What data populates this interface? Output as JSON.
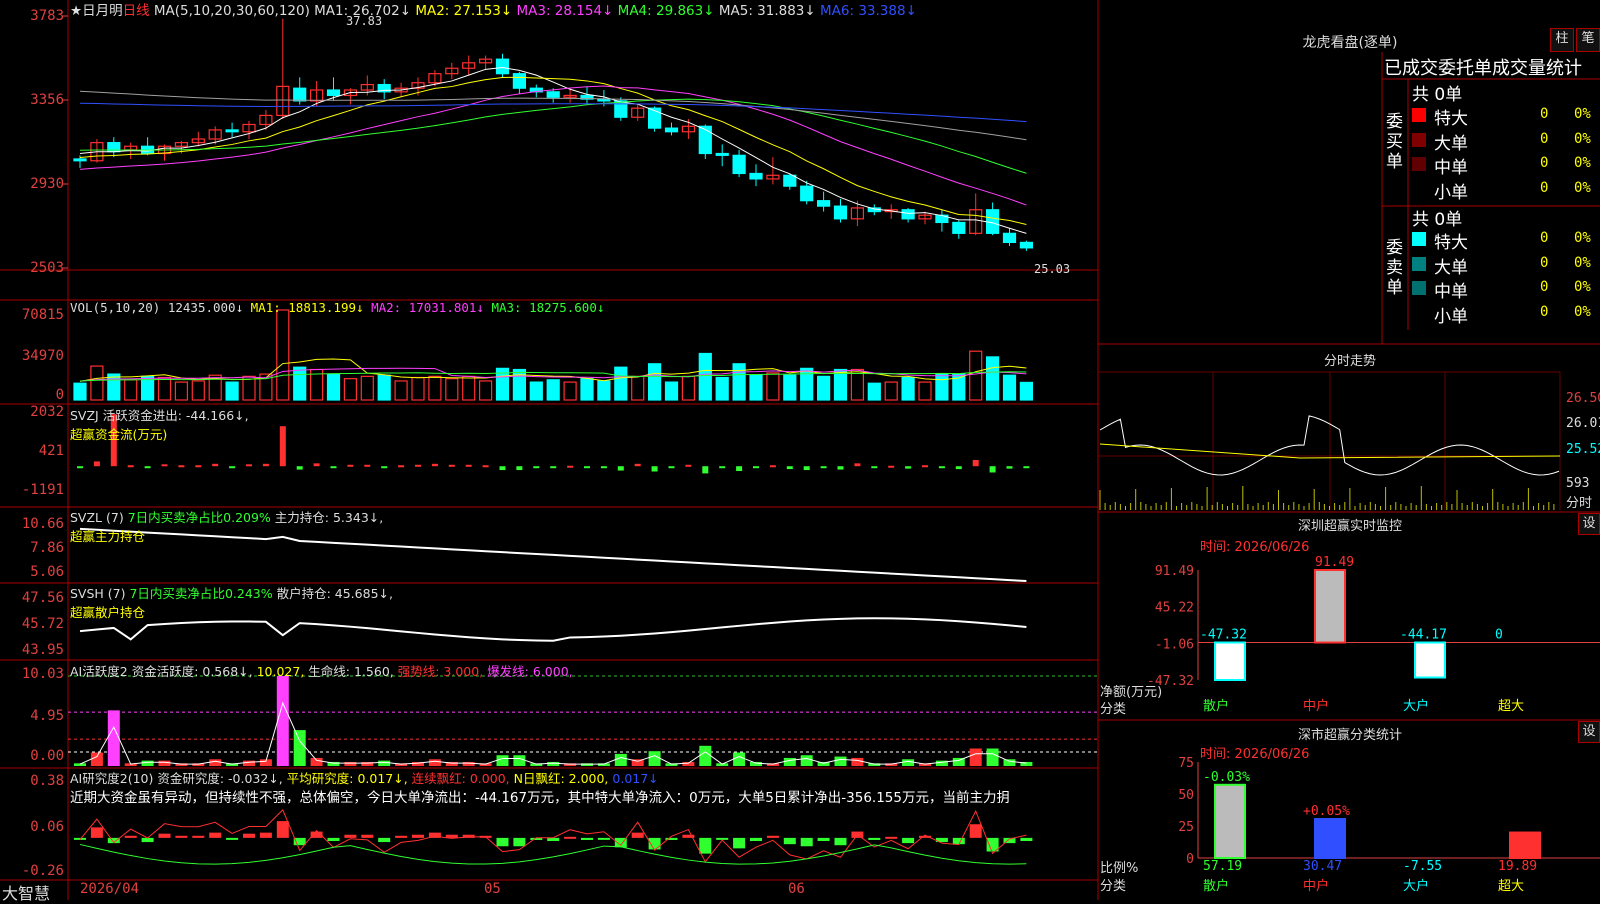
{
  "colors": {
    "up": "#ff3030",
    "down": "#00ffff",
    "grid": "#aa0000",
    "ma1": "#ffffff",
    "ma2": "#ffff00",
    "ma3": "#ff40ff",
    "ma4": "#30ff30",
    "ma5": "#a0a0a0",
    "ma6": "#3050ff"
  },
  "header": {
    "star_label": "★日月明",
    "period": "日线",
    "ma_def": "MA(5,10,20,30,60,120)",
    "ma1": "MA1: 26.702↓",
    "ma2": "MA2: 27.153↓",
    "ma3": "MA3: 28.154↓",
    "ma4": "MA4: 29.863↓",
    "ma5": "MA5: 31.883↓",
    "ma6": "MA6: 33.388↓",
    "high_mark": "37.83",
    "low_mark": "25.03"
  },
  "price_axis": [
    "3783",
    "3356",
    "2930",
    "2503"
  ],
  "vol": {
    "label": "VOL(5,10,20)",
    "v": "12435.000↓",
    "ma1": "MA1: 18813.199↓",
    "ma2": "MA2: 17031.801↓",
    "ma3": "MA3: 18275.600↓",
    "axis": [
      "70815",
      "34970",
      "0"
    ]
  },
  "svzj": {
    "label": "SVZJ",
    "text": "活跃资金进出: -44.166↓,",
    "sub": "超赢资金流(万元)",
    "axis": [
      "2032",
      "421",
      "-1191"
    ]
  },
  "svzl": {
    "label": "SVZL (7)",
    "text1": "7日内买卖净占比0.209%",
    "text2": "主力持仓: 5.343↓,",
    "sub": "超赢主力持仓",
    "axis": [
      "10.66",
      "7.86",
      "5.06"
    ]
  },
  "svsh": {
    "label": "SVSH (7)",
    "text1": "7日内买卖净占比0.243%",
    "text2": "散户持仓: 45.685↓,",
    "sub": "超赢散户持仓",
    "axis": [
      "47.56",
      "45.72",
      "43.95"
    ]
  },
  "ai2": {
    "label": "AI活跃度2",
    "t1": "资金活跃度: 0.568↓,",
    "t2": "10.027,",
    "t3": "生命线: 1.560,",
    "t4": "强势线: 3.000,",
    "t5": "爆发线: 6.000,",
    "axis": [
      "10.03",
      "4.95",
      "0.00"
    ]
  },
  "ai_research": {
    "label": "AI研究度2(10)",
    "t1": "资金研究度: -0.032↓,",
    "t2": "平均研究度: 0.017↓,",
    "t3": "连续飘红: 0.000,",
    "t4": "N日飘红: 2.000,",
    "t5": "0.017↓",
    "summary": "近期大资金虽有异动，但持续性不强，总体偏空，今日大单净流出：-44.167万元，其中特大单净流入：0万元，大单5日累计净出-356.155万元，当前主力抈",
    "axis": [
      "0.38",
      "0.06",
      "-0.26"
    ]
  },
  "bottom": {
    "brand": "大智慧",
    "dates": [
      "2026/04",
      "05",
      "06"
    ]
  },
  "lhkp": {
    "title": "龙虎看盘(逐单)",
    "btn1": "柱",
    "btn2": "笔",
    "heading": "已成交委托单成交量统计",
    "buy_label": "委买单",
    "sell_label": "委卖单",
    "buy_total": "共 0单",
    "sell_total": "共 0单",
    "buy_rows": [
      {
        "name": "特大",
        "v": "0",
        "p": "0%",
        "color": "#ff0000"
      },
      {
        "name": "大单",
        "v": "0",
        "p": "0%",
        "color": "#800000"
      },
      {
        "name": "中单",
        "v": "0",
        "p": "0%",
        "color": "#600000"
      },
      {
        "name": "小单",
        "v": "0",
        "p": "0%",
        "color": "#000"
      }
    ],
    "sell_rows": [
      {
        "name": "特大",
        "v": "0",
        "p": "0%",
        "color": "#00ffff"
      },
      {
        "name": "大单",
        "v": "0",
        "p": "0%",
        "color": "#008080"
      },
      {
        "name": "中单",
        "v": "0",
        "p": "0%",
        "color": "#007070"
      },
      {
        "name": "小单",
        "v": "0",
        "p": "0%",
        "color": "#000"
      }
    ]
  },
  "intraday": {
    "title": "分时走势",
    "axis": [
      "26.50",
      "26.01",
      "25.52",
      "593"
    ],
    "unit": "分时"
  },
  "sz_monitor": {
    "title": "深圳超赢实时监控",
    "btn": "设",
    "time": "时间: 2026/06/26",
    "ylabel": "净额(万元)",
    "xlabel": "分类",
    "axis": [
      "91.49",
      "45.22",
      "-1.06",
      "-47.32"
    ],
    "cats": [
      "散户",
      "中户",
      "大户",
      "超大"
    ],
    "values": [
      "-47.32",
      "91.49",
      "-44.17",
      "0"
    ]
  },
  "sz_class": {
    "title": "深市超赢分类统计",
    "btn": "设",
    "time": "时间: 2026/06/26",
    "ylabel": "比例%",
    "xlabel": "分类",
    "axis": [
      "75",
      "50",
      "25",
      "0"
    ],
    "cats": [
      "散户",
      "中户",
      "大户",
      "超大"
    ],
    "values": [
      "57.19",
      "30.47",
      "-7.55",
      "19.89"
    ],
    "tops": [
      "-0.03%",
      "+0.05%",
      "",
      ""
    ]
  },
  "chart_data": [
    {
      "type": "candlestick",
      "title": "日线",
      "ylim": [
        25.03,
        37.83
      ],
      "series": [
        {
          "name": "MA1",
          "last": 26.702
        },
        {
          "name": "MA2",
          "last": 27.153
        },
        {
          "name": "MA3",
          "last": 28.154
        },
        {
          "name": "MA4",
          "last": 29.863
        },
        {
          "name": "MA5",
          "last": 31.883
        },
        {
          "name": "MA6",
          "last": 33.388
        }
      ],
      "candles": [
        [
          30.1,
          30.3,
          29.6,
          30.0
        ],
        [
          30.0,
          31.2,
          29.9,
          31.0
        ],
        [
          31.0,
          31.3,
          30.2,
          30.5
        ],
        [
          30.6,
          31.0,
          30.1,
          30.8
        ],
        [
          30.8,
          31.3,
          30.3,
          30.4
        ],
        [
          30.4,
          30.9,
          30.0,
          30.8
        ],
        [
          30.8,
          31.1,
          30.4,
          31.0
        ],
        [
          31.0,
          31.6,
          30.8,
          31.2
        ],
        [
          31.2,
          31.9,
          30.9,
          31.7
        ],
        [
          31.7,
          32.1,
          31.3,
          31.6
        ],
        [
          31.6,
          32.2,
          31.2,
          32.0
        ],
        [
          32.0,
          32.8,
          31.7,
          32.5
        ],
        [
          32.5,
          37.83,
          32.3,
          34.1
        ],
        [
          34.0,
          34.6,
          33.1,
          33.3
        ],
        [
          33.3,
          34.4,
          33.0,
          33.9
        ],
        [
          33.9,
          34.6,
          33.3,
          33.6
        ],
        [
          33.6,
          34.0,
          33.1,
          33.9
        ],
        [
          33.9,
          34.7,
          33.6,
          34.2
        ],
        [
          34.2,
          34.5,
          33.4,
          33.8
        ],
        [
          33.8,
          34.3,
          33.5,
          34.0
        ],
        [
          34.0,
          34.6,
          33.6,
          34.3
        ],
        [
          34.3,
          35.0,
          34.1,
          34.8
        ],
        [
          34.8,
          35.4,
          34.5,
          35.1
        ],
        [
          35.1,
          35.8,
          34.7,
          35.4
        ],
        [
          35.4,
          35.8,
          35.0,
          35.6
        ],
        [
          35.6,
          35.9,
          34.6,
          34.8
        ],
        [
          34.8,
          34.9,
          33.7,
          34.0
        ],
        [
          34.0,
          34.2,
          33.5,
          33.8
        ],
        [
          33.8,
          34.0,
          33.2,
          33.5
        ],
        [
          33.5,
          34.0,
          33.2,
          33.6
        ],
        [
          33.6,
          34.1,
          33.1,
          33.4
        ],
        [
          33.4,
          33.9,
          33.0,
          33.3
        ],
        [
          33.3,
          33.5,
          32.2,
          32.4
        ],
        [
          32.4,
          33.1,
          32.2,
          32.9
        ],
        [
          32.9,
          33.0,
          31.6,
          31.8
        ],
        [
          31.8,
          32.1,
          31.4,
          31.6
        ],
        [
          31.6,
          32.3,
          31.2,
          31.9
        ],
        [
          31.9,
          32.0,
          30.1,
          30.4
        ],
        [
          30.4,
          30.9,
          29.7,
          30.3
        ],
        [
          30.3,
          30.6,
          29.1,
          29.3
        ],
        [
          29.3,
          29.8,
          28.6,
          29.0
        ],
        [
          29.0,
          30.2,
          28.7,
          29.2
        ],
        [
          29.2,
          29.3,
          28.4,
          28.6
        ],
        [
          28.6,
          28.9,
          27.6,
          27.8
        ],
        [
          27.8,
          28.3,
          27.2,
          27.5
        ],
        [
          27.5,
          27.9,
          26.6,
          26.8
        ],
        [
          26.8,
          27.8,
          26.4,
          27.4
        ],
        [
          27.4,
          27.6,
          27.0,
          27.2
        ],
        [
          27.2,
          27.6,
          26.8,
          27.3
        ],
        [
          27.3,
          27.4,
          26.6,
          26.8
        ],
        [
          26.8,
          27.2,
          26.5,
          27.0
        ],
        [
          27.0,
          27.3,
          26.1,
          26.6
        ],
        [
          26.6,
          26.7,
          25.7,
          26.0
        ],
        [
          26.0,
          28.2,
          25.9,
          27.3
        ],
        [
          27.3,
          27.7,
          25.9,
          26.0
        ],
        [
          26.0,
          26.3,
          25.3,
          25.5
        ],
        [
          25.5,
          25.6,
          25.03,
          25.2
        ]
      ]
    },
    {
      "type": "bar",
      "title": "VOL(5,10,20)",
      "ylim": [
        0,
        70815
      ],
      "series": [
        {
          "name": "MA1",
          "last": 18813.199
        },
        {
          "name": "MA2",
          "last": 17031.801
        },
        {
          "name": "MA3",
          "last": 18275.6
        }
      ]
    },
    {
      "type": "bar",
      "title": "超赢资金流(万元)",
      "ylim": [
        -1191,
        2032
      ],
      "series": [
        {
          "name": "活跃资金进出",
          "last": -44.166
        }
      ]
    },
    {
      "type": "line",
      "title": "超赢主力持仓",
      "ylim": [
        5.06,
        10.66
      ],
      "series": [
        {
          "name": "主力持仓",
          "last": 5.343
        }
      ]
    },
    {
      "type": "line",
      "title": "超赢散户持仓",
      "ylim": [
        43.95,
        47.56
      ],
      "series": [
        {
          "name": "散户持仓",
          "last": 45.685
        }
      ]
    },
    {
      "type": "bar",
      "title": "AI活跃度2",
      "ylim": [
        0,
        10.03
      ],
      "series": [
        {
          "name": "资金活跃度",
          "last": 0.568
        },
        {
          "name": "生命线",
          "last": 1.56
        },
        {
          "name": "强势线",
          "last": 3.0
        },
        {
          "name": "爆发线",
          "last": 6.0
        }
      ]
    },
    {
      "type": "bar",
      "title": "AI研究度2(10)",
      "ylim": [
        -0.26,
        0.38
      ],
      "series": [
        {
          "name": "资金研究度",
          "last": -0.032
        },
        {
          "name": "平均研究度",
          "last": 0.017
        }
      ]
    },
    {
      "type": "bar",
      "title": "深圳超赢实时监控",
      "categories": [
        "散户",
        "中户",
        "大户",
        "超大"
      ],
      "values": [
        -47.32,
        91.49,
        -44.17,
        0
      ],
      "ylim": [
        -47.32,
        91.49
      ]
    },
    {
      "type": "bar",
      "title": "深市超赢分类统计",
      "categories": [
        "散户",
        "中户",
        "大户",
        "超大"
      ],
      "values": [
        57.19,
        30.47,
        -7.55,
        19.89
      ],
      "ylim": [
        0,
        75
      ]
    }
  ]
}
